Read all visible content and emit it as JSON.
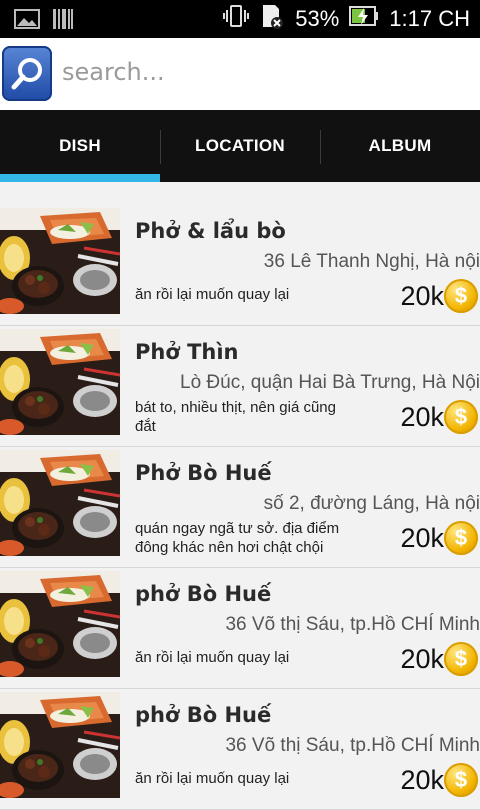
{
  "status_bar": {
    "battery_percent": "53%",
    "time": "1:17 CH",
    "icons": [
      "image-icon",
      "barcode-icon",
      "vibrate-icon",
      "sd-card-icon",
      "battery-charging-icon"
    ]
  },
  "search": {
    "placeholder": "search...",
    "value": "",
    "button_icon": "search-icon"
  },
  "tabs": [
    {
      "label": "DISH",
      "selected": true
    },
    {
      "label": "LOCATION",
      "selected": false
    },
    {
      "label": "ALBUM",
      "selected": false
    }
  ],
  "colors": {
    "tab_indicator": "#33b5e5",
    "coin": "#f2b400",
    "tab_bar": "#111111"
  },
  "dishes": [
    {
      "name": "Phở & lẩu bò",
      "address": "36 Lê Thanh Nghị, Hà nội",
      "note": "ăn rồi lại muốn quay lại",
      "price": "20k"
    },
    {
      "name": "Phở Thìn",
      "address": "Lò Đúc, quận Hai Bà Trưng, Hà Nội",
      "note": "bát to, nhiều thịt, nên giá cũng đắt",
      "price": "20k"
    },
    {
      "name": "Phở  Bò Huế",
      "address": "số 2, đường Láng, Hà nội",
      "note": "quán ngay ngã tư sở. địa điểm đông khác nên hơi chật chội",
      "price": "20k"
    },
    {
      "name": "phở Bò Huế",
      "address": "36 Võ thị Sáu, tp.Hồ CHÍ Minh",
      "note": "ăn rồi lại muốn quay lại",
      "price": "20k"
    },
    {
      "name": "phở Bò Huế",
      "address": "36 Võ thị Sáu, tp.Hồ CHÍ Minh",
      "note": "ăn rồi lại muốn quay lại",
      "price": "20k"
    }
  ],
  "coin_symbol": "$"
}
